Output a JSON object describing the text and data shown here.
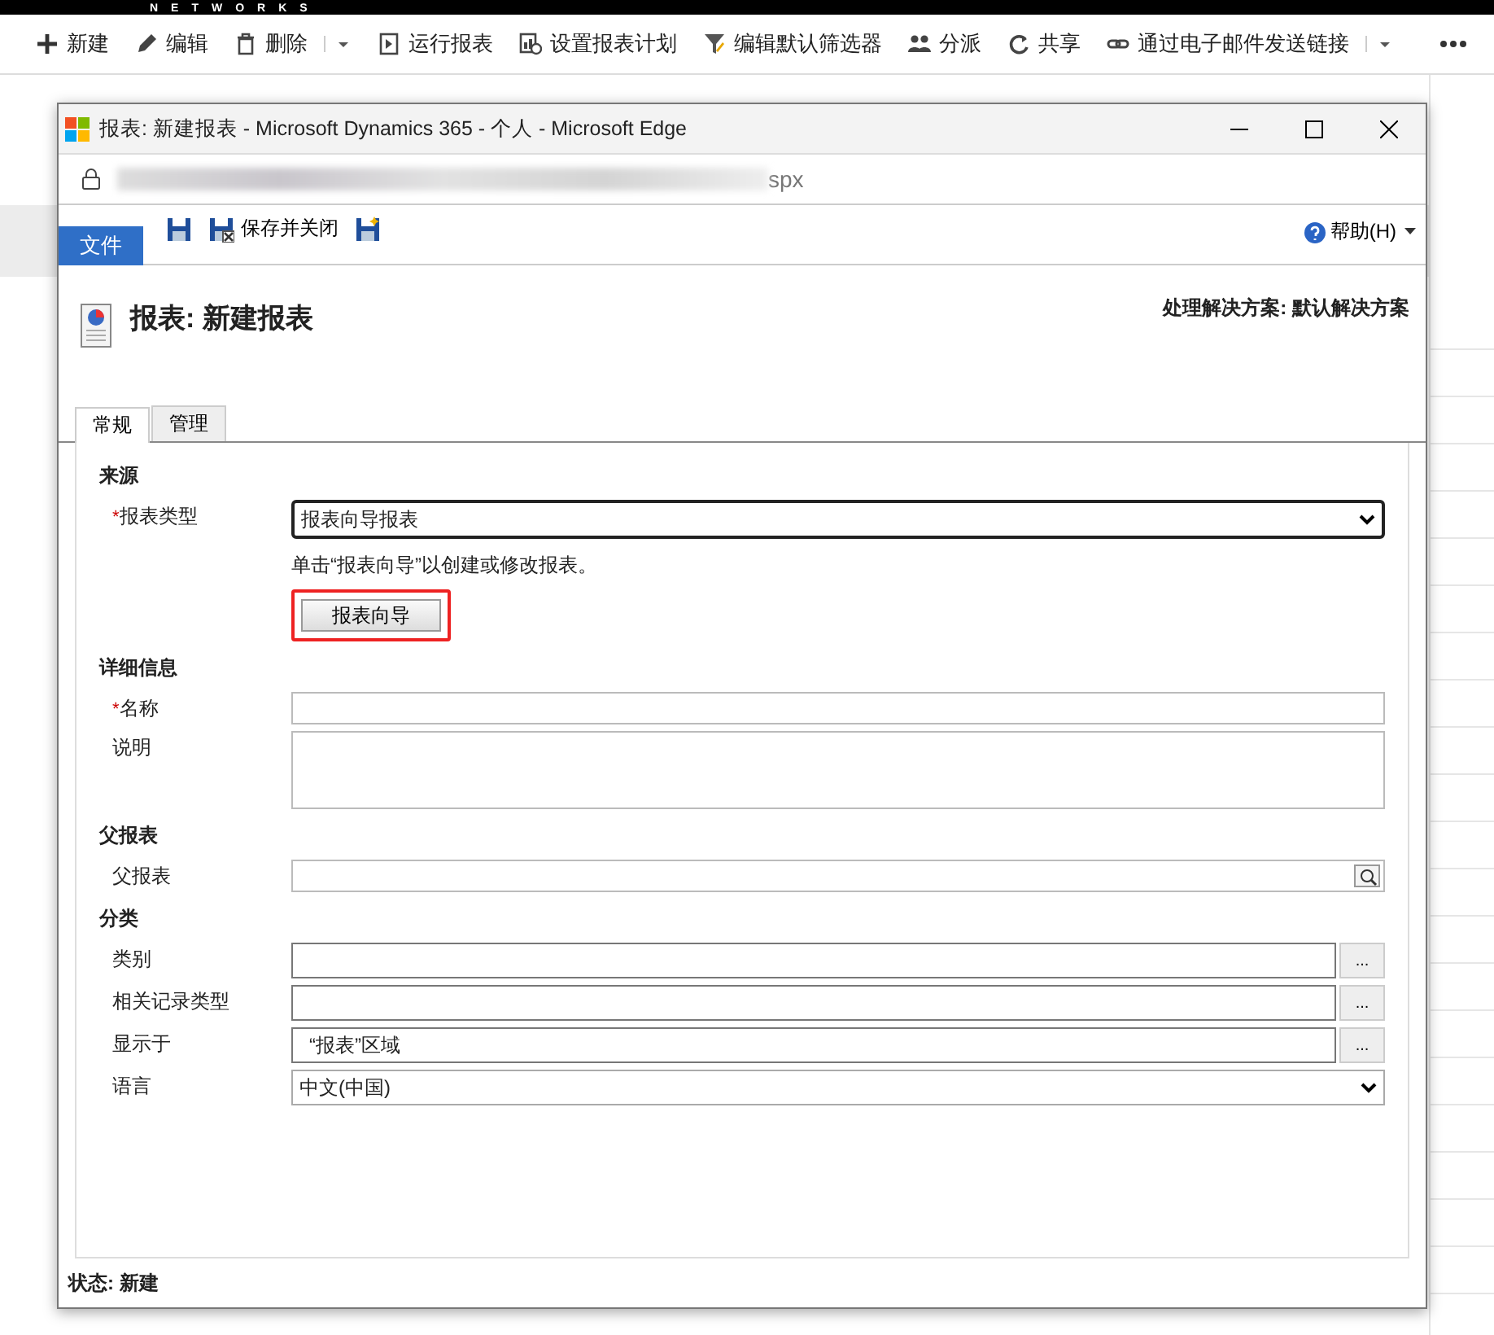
{
  "brand_bar": {
    "text": "NETWORKS"
  },
  "command_bar": {
    "items": [
      {
        "label": "新建",
        "has_menu": false
      },
      {
        "label": "编辑",
        "has_menu": false
      },
      {
        "label": "删除",
        "has_menu": true
      },
      {
        "label": "运行报表",
        "has_menu": false
      },
      {
        "label": "设置报表计划",
        "has_menu": false
      },
      {
        "label": "编辑默认筛选器",
        "has_menu": false
      },
      {
        "label": "分派",
        "has_menu": false
      },
      {
        "label": "共享",
        "has_menu": false
      },
      {
        "label": "通过电子邮件发送链接",
        "has_menu": true
      }
    ]
  },
  "window": {
    "title": "报表: 新建报表 - Microsoft Dynamics 365 - 个人 - Microsoft Edge",
    "address": "spx"
  },
  "ribbon": {
    "file_tab": "文件",
    "buttons": [
      {
        "kind": "icon"
      },
      {
        "kind": "labeled",
        "label": "保存并关闭"
      },
      {
        "kind": "icon"
      }
    ],
    "help": "帮助(H)"
  },
  "header": {
    "title": "报表: 新建报表",
    "solution": "处理解决方案: 默认解决方案"
  },
  "tabs": [
    {
      "label": "常规",
      "selected": true
    },
    {
      "label": "管理",
      "selected": false
    }
  ],
  "sections": [
    {
      "title": "来源",
      "fields": [
        {
          "kind": "select",
          "required_mark": "*",
          "label": "报表类型",
          "value": "报表向导报表",
          "focused": true
        },
        {
          "kind": "note",
          "text": "单击“报表向导”以创建或修改报表。"
        },
        {
          "kind": "button",
          "text": "报表向导",
          "highlighted": true
        }
      ]
    },
    {
      "title": "详细信息",
      "fields": [
        {
          "kind": "text",
          "required_mark": "*",
          "label": "名称"
        },
        {
          "kind": "textarea",
          "label": "说明"
        }
      ]
    },
    {
      "title": "父报表",
      "fields": [
        {
          "kind": "lookup",
          "label": "父报表"
        }
      ]
    },
    {
      "title": "分类",
      "fields": [
        {
          "kind": "picker",
          "label": "类别",
          "button_text": "..."
        },
        {
          "kind": "picker",
          "label": "相关记录类型",
          "button_text": "..."
        },
        {
          "kind": "picker",
          "label": "显示于",
          "value": "“报表”区域",
          "button_text": "..."
        },
        {
          "kind": "select",
          "label": "语言",
          "value": "中文(中国)",
          "focused": false
        }
      ]
    }
  ],
  "status": "状态: 新建"
}
